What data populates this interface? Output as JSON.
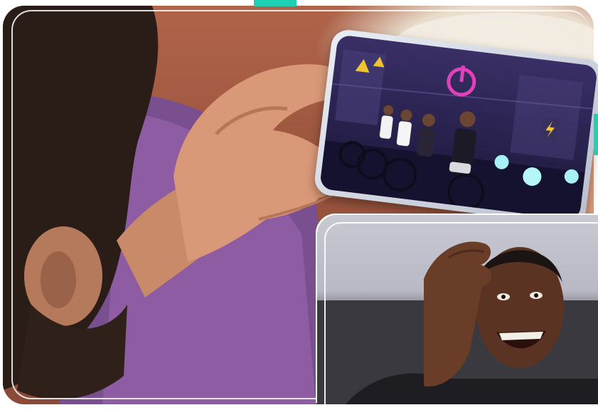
{
  "scene": {
    "main_image": "person-watching-phone",
    "phone_screen": "cycling-show-stage",
    "inset_image": "excited-laughing-man"
  },
  "colors": {
    "accent": "#1fd1b2",
    "frame": "#ffffff",
    "power_icon": "#e040b8"
  },
  "icons": [
    "power-icon",
    "warning-icon",
    "lightning-icon"
  ]
}
